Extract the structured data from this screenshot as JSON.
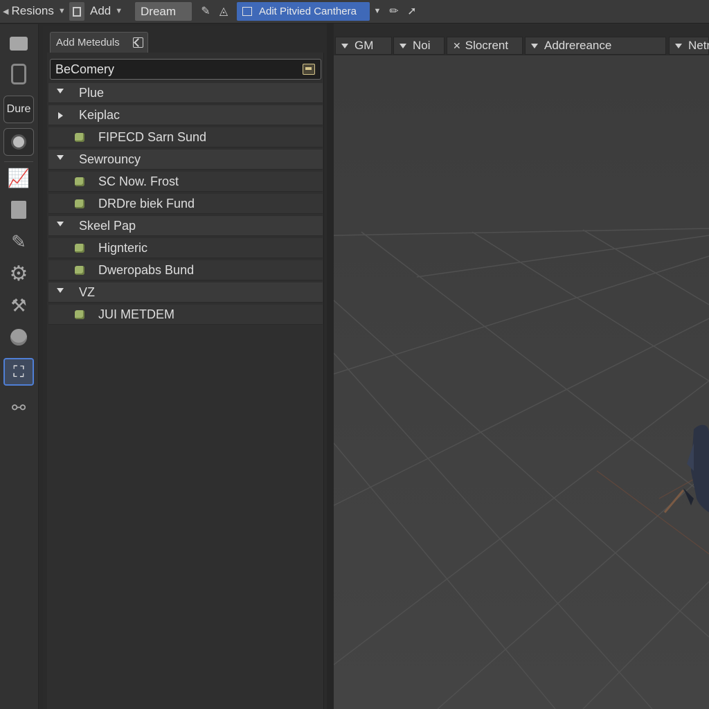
{
  "menu": {
    "resions_label": "Resions",
    "add_label": "Add",
    "dream_label": "Dream",
    "camera_label": "Adit Pitvied Canthera"
  },
  "panel": {
    "tab_label": "Add Meteduls",
    "search_value": "BeComery"
  },
  "tree": [
    {
      "label": "Plue",
      "kind": "group",
      "expanded": true
    },
    {
      "label": "Keiplac",
      "kind": "group",
      "expanded": false
    },
    {
      "label": "FIPECD Sarn Sund",
      "kind": "item"
    },
    {
      "label": "Sewrouncy",
      "kind": "group",
      "expanded": true
    },
    {
      "label": "SC Now. Frost",
      "kind": "item"
    },
    {
      "label": "DRDre biek Fund",
      "kind": "item"
    },
    {
      "label": "Skeel Pap",
      "kind": "group",
      "expanded": true
    },
    {
      "label": "Hignteric",
      "kind": "item"
    },
    {
      "label": "Dweropabs Bund",
      "kind": "item"
    },
    {
      "label": "VZ",
      "kind": "group",
      "expanded": true
    },
    {
      "label": "JUI METDEM",
      "kind": "item"
    }
  ],
  "viewport_header": {
    "gm_label": "GM",
    "noi_label": "Noi",
    "slocrent_label": "Slocrent",
    "addrereance_label": "Addrereance",
    "netr_label": "Netr"
  },
  "sidebar_tools": {
    "dure_label": "Dure"
  },
  "colors": {
    "accent": "#4f7fd6",
    "item_dot": "#9fb46a",
    "viewport_bg": "#3e3e3e"
  }
}
